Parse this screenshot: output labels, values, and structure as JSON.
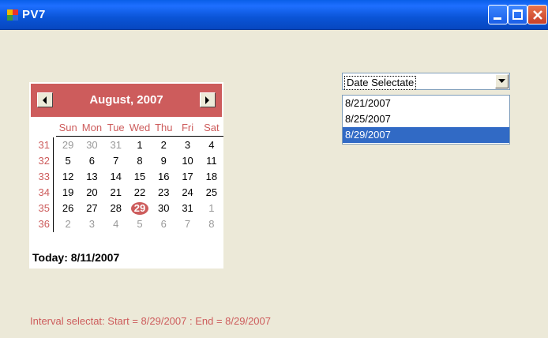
{
  "window": {
    "title": "PV7"
  },
  "calendar": {
    "month_title": "August, 2007",
    "weekdays": [
      "Sun",
      "Mon",
      "Tue",
      "Wed",
      "Thu",
      "Fri",
      "Sat"
    ],
    "weeks": [
      {
        "week": "31",
        "days": [
          [
            "29",
            true
          ],
          [
            "30",
            true
          ],
          [
            "31",
            true
          ],
          [
            "1",
            false
          ],
          [
            "2",
            false
          ],
          [
            "3",
            false
          ],
          [
            "4",
            false
          ]
        ]
      },
      {
        "week": "32",
        "days": [
          [
            "5",
            false
          ],
          [
            "6",
            false
          ],
          [
            "7",
            false
          ],
          [
            "8",
            false
          ],
          [
            "9",
            false
          ],
          [
            "10",
            false
          ],
          [
            "11",
            false
          ]
        ]
      },
      {
        "week": "33",
        "days": [
          [
            "12",
            false
          ],
          [
            "13",
            false
          ],
          [
            "14",
            false
          ],
          [
            "15",
            false
          ],
          [
            "16",
            false
          ],
          [
            "17",
            false
          ],
          [
            "18",
            false
          ]
        ]
      },
      {
        "week": "34",
        "days": [
          [
            "19",
            false
          ],
          [
            "20",
            false
          ],
          [
            "21",
            false
          ],
          [
            "22",
            false
          ],
          [
            "23",
            false
          ],
          [
            "24",
            false
          ],
          [
            "25",
            false
          ]
        ]
      },
      {
        "week": "35",
        "days": [
          [
            "26",
            false
          ],
          [
            "27",
            false
          ],
          [
            "28",
            false
          ],
          [
            "29",
            false
          ],
          [
            "30",
            false
          ],
          [
            "31",
            false
          ],
          [
            "1",
            true
          ]
        ]
      },
      {
        "week": "36",
        "days": [
          [
            "2",
            true
          ],
          [
            "3",
            true
          ],
          [
            "4",
            true
          ],
          [
            "5",
            true
          ],
          [
            "6",
            true
          ],
          [
            "7",
            true
          ],
          [
            "8",
            true
          ]
        ]
      }
    ],
    "selected_day": "29",
    "today_label": "Today: 8/11/2007",
    "accent_color": "#cd5c5c"
  },
  "date_combo": {
    "value": "Date Selectate"
  },
  "date_list": {
    "items": [
      "8/21/2007",
      "8/25/2007",
      "8/29/2007"
    ],
    "selected_index": 2
  },
  "status": {
    "text": "Interval selectat: Start = 8/29/2007 : End = 8/29/2007"
  }
}
